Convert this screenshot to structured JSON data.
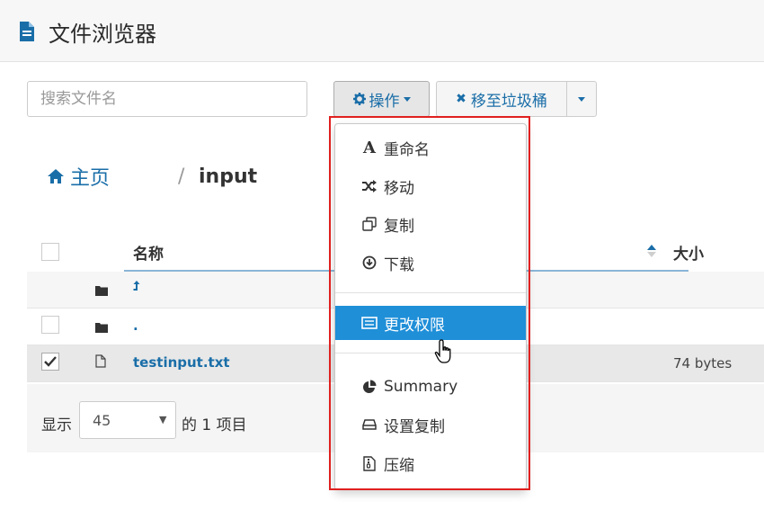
{
  "header": {
    "title": "文件浏览器"
  },
  "search": {
    "placeholder": "搜索文件名"
  },
  "toolbar": {
    "actions_label": "操作",
    "trash_label": "移至垃圾桶"
  },
  "breadcrumb": {
    "home": "主页",
    "separator": "/",
    "current": "input"
  },
  "table": {
    "columns": {
      "name": "名称",
      "size": "大小"
    },
    "rows": [
      {
        "name": "",
        "size": "",
        "checked": false
      },
      {
        "name": ".",
        "size": "",
        "checked": false
      },
      {
        "name": "testinput.txt",
        "size": "74 bytes",
        "checked": true
      }
    ]
  },
  "footer": {
    "show_label": "显示",
    "page_size": "45",
    "count_label": "的 1 项目"
  },
  "menu": {
    "items": [
      {
        "label": "重命名",
        "icon": "font-icon"
      },
      {
        "label": "移动",
        "icon": "shuffle-icon"
      },
      {
        "label": "复制",
        "icon": "copy-icon"
      },
      {
        "label": "下载",
        "icon": "download-icon"
      },
      {
        "label": "更改权限",
        "icon": "list-icon"
      },
      {
        "label": "Summary",
        "icon": "pie-chart-icon"
      },
      {
        "label": "设置复制",
        "icon": "drive-icon"
      },
      {
        "label": "压缩",
        "icon": "archive-icon"
      }
    ],
    "active_index": 4
  },
  "colors": {
    "accent": "#1a6ea8",
    "active": "#1f8fd8",
    "highlight_border": "#e02020"
  }
}
